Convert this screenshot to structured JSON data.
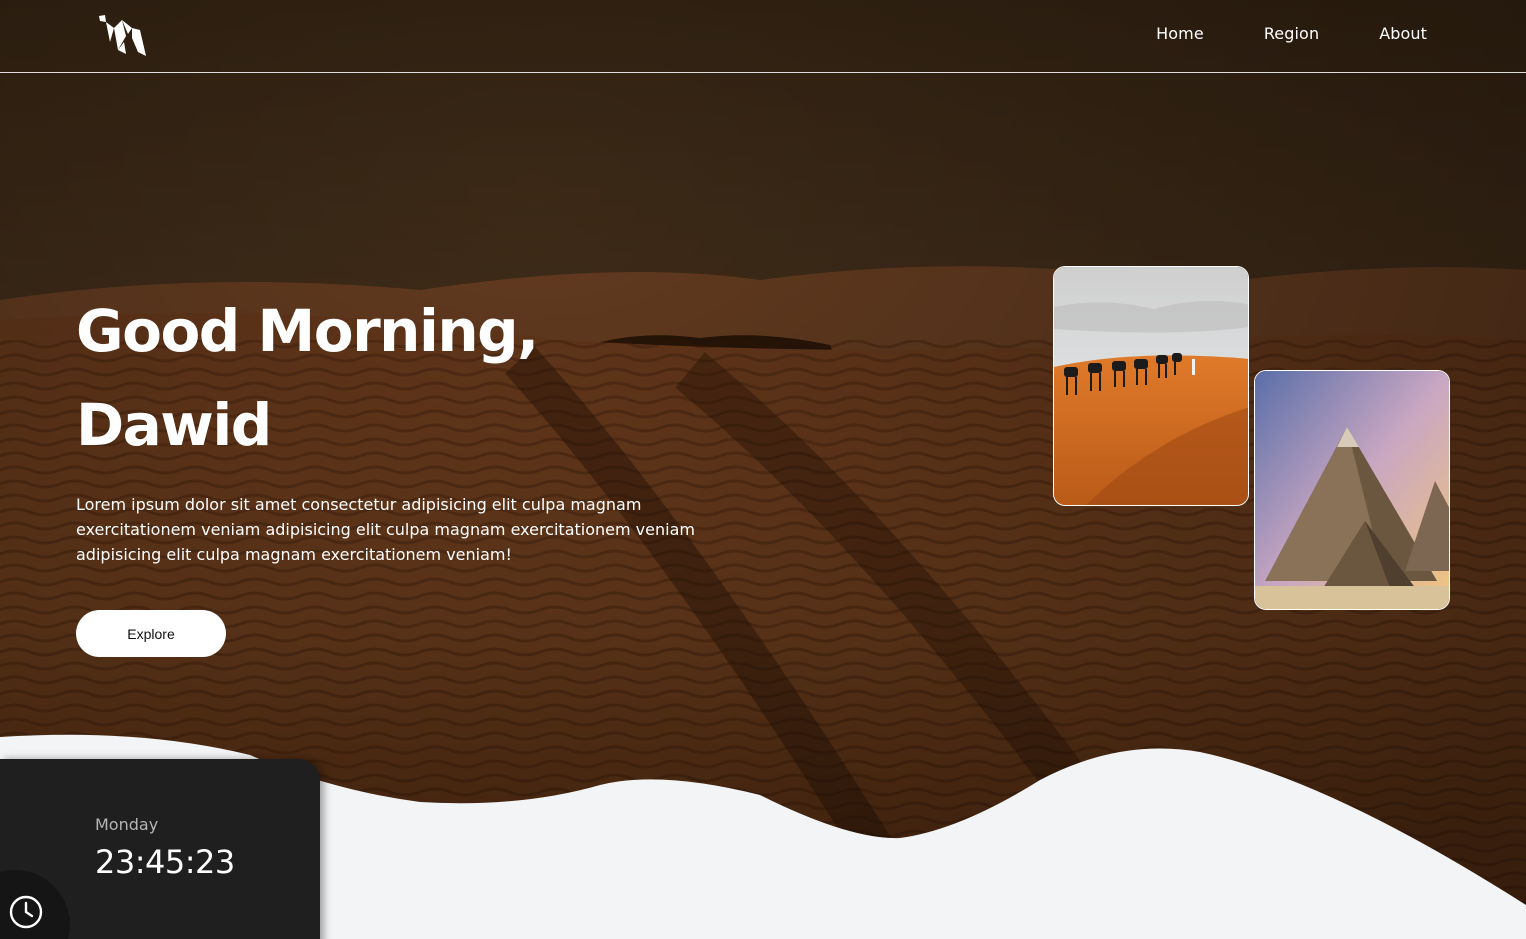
{
  "header": {
    "logo_icon": "origami-camel-logo-icon",
    "nav": [
      {
        "label": "Home"
      },
      {
        "label": "Region"
      },
      {
        "label": "About"
      }
    ]
  },
  "hero": {
    "greeting_line1": "Good Morning,",
    "greeting_line2": "Dawid",
    "description": "Lorem ipsum dolor sit amet consectetur adipisicing elit culpa magnam exercitationem veniam adipisicing elit culpa magnam exercitationem veniam adipisicing elit culpa magnam exercitationem veniam!",
    "explore_label": "Explore"
  },
  "gallery": [
    {
      "icon": "camel-caravan-photo"
    },
    {
      "icon": "pyramids-photo"
    }
  ],
  "clock": {
    "day": "Monday",
    "time": "23:45:23",
    "icon": "clock-icon"
  },
  "colors": {
    "accent_white": "#ffffff",
    "panel_dark": "#1f1f1f",
    "wave_light": "#f3f4f6",
    "sand": "#8a4f24"
  }
}
